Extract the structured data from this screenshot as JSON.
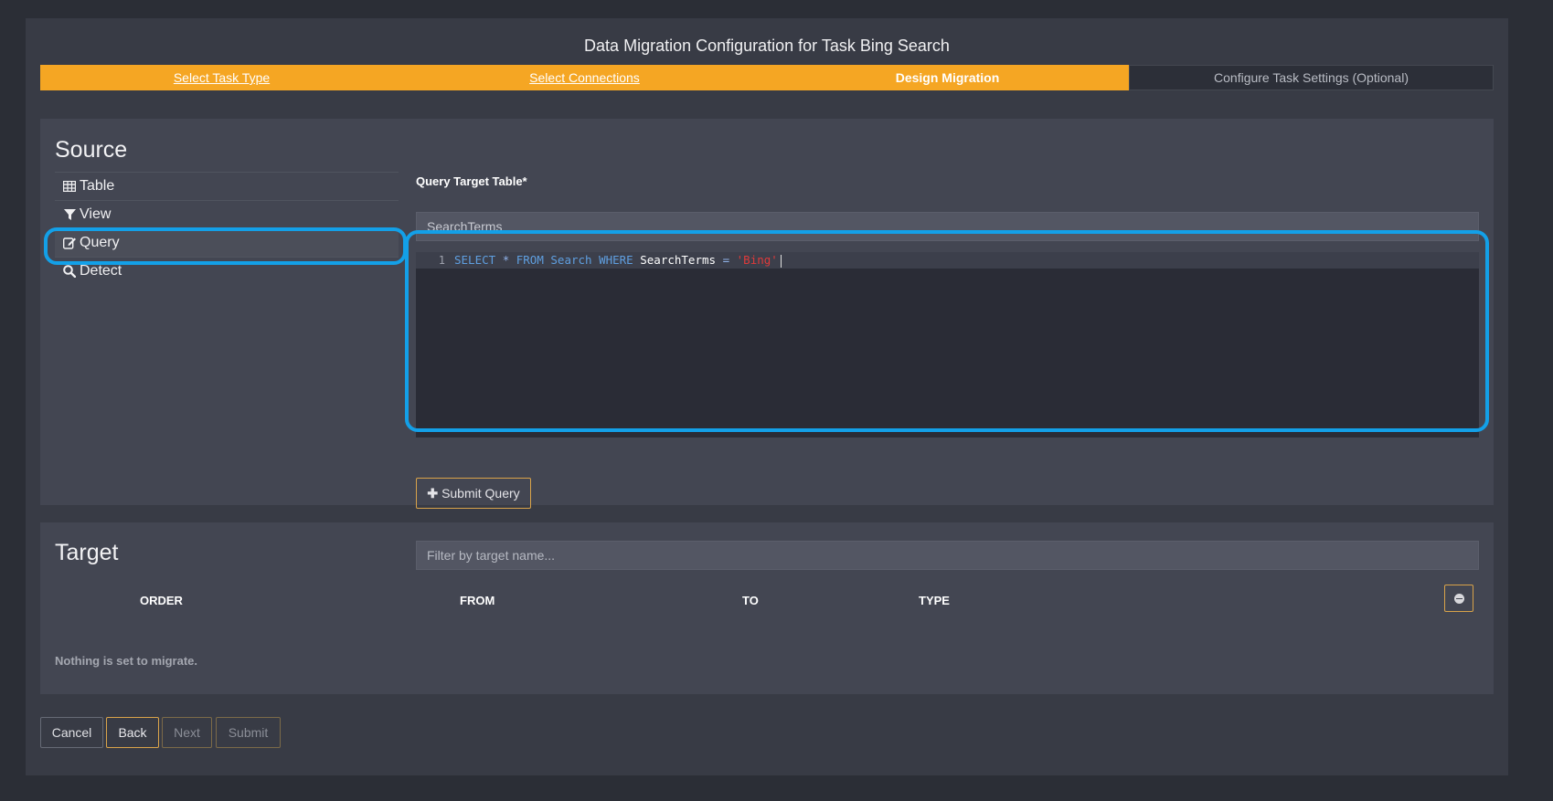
{
  "page": {
    "title": "Data Migration Configuration for Task Bing Search"
  },
  "steps": [
    {
      "label": "Select Task Type",
      "state": "done"
    },
    {
      "label": "Select Connections",
      "state": "done"
    },
    {
      "label": "Design Migration",
      "state": "active"
    },
    {
      "label": "Configure Task Settings (Optional)",
      "state": "todo"
    }
  ],
  "source": {
    "heading": "Source",
    "nav": [
      {
        "label": "Table",
        "icon": "table-icon"
      },
      {
        "label": "View",
        "icon": "filter-icon"
      },
      {
        "label": "Query",
        "icon": "edit-icon",
        "active": true
      },
      {
        "label": "Detect",
        "icon": "search-icon"
      }
    ],
    "query_target_label": "Query Target Table*",
    "query_target_value": "SearchTerms",
    "editor": {
      "line_number": "1",
      "tokens": {
        "select": "SELECT",
        "star": "*",
        "from": "FROM",
        "table": "Search",
        "where": "WHERE",
        "column": "SearchTerms",
        "eq": "=",
        "value": "'Bing'"
      }
    },
    "submit_label": "Submit Query"
  },
  "target": {
    "heading": "Target",
    "filter_placeholder": "Filter by target name...",
    "columns": [
      "ORDER",
      "FROM",
      "TO",
      "TYPE"
    ],
    "empty_message": "Nothing is set to migrate."
  },
  "footer": {
    "cancel": "Cancel",
    "back": "Back",
    "next": "Next",
    "submit": "Submit"
  },
  "colors": {
    "accent": "#f5a623",
    "highlight": "#13a0e8"
  }
}
